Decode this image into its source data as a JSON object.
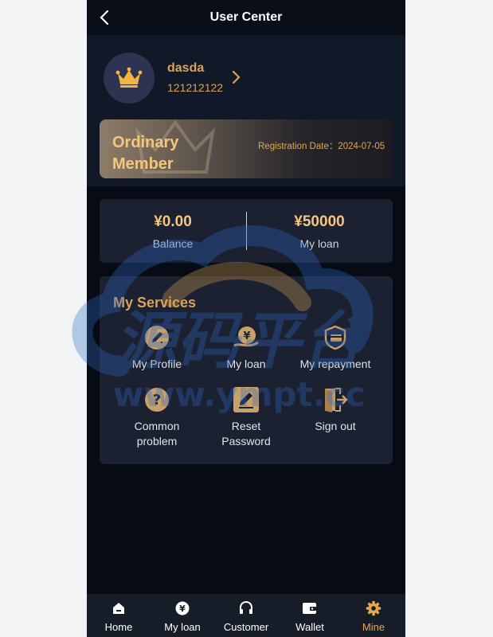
{
  "header": {
    "title": "User Center",
    "back_icon": "chevron-left-icon"
  },
  "profile": {
    "username": "dasda",
    "user_id": "121212122",
    "avatar_icon": "crown-icon",
    "arrow_icon": "chevron-right-icon"
  },
  "membership": {
    "level": "Ordinary Member",
    "registration": "Registration Date：2024-07-05"
  },
  "account": {
    "balance_value": "¥0.00",
    "balance_label": "Balance",
    "loan_value": "¥50000",
    "loan_label": "My loan"
  },
  "services": {
    "title": "My Services",
    "items": [
      {
        "label": "My Profile",
        "icon": "edit-circle-icon"
      },
      {
        "label": "My loan",
        "icon": "yen-hand-icon"
      },
      {
        "label": "My repayment",
        "icon": "shield-card-icon"
      },
      {
        "label": "Common problem",
        "icon": "question-circle-icon"
      },
      {
        "label": "Reset Password",
        "icon": "pencil-square-icon"
      },
      {
        "label": "Sign out",
        "icon": "logout-door-icon"
      }
    ]
  },
  "watermark": {
    "title": "源码平台",
    "url": "www.ympt.cc"
  },
  "tabbar": {
    "items": [
      {
        "label": "Home",
        "icon": "home-icon"
      },
      {
        "label": "My loan",
        "icon": "yen-circle-icon"
      },
      {
        "label": "Customer",
        "icon": "headset-icon"
      },
      {
        "label": "Wallet",
        "icon": "wallet-icon"
      },
      {
        "label": "Mine",
        "icon": "gear-icon"
      }
    ],
    "active": "Mine"
  },
  "colors": {
    "gold": "#d9a35a",
    "gold_light": "#f3c77d",
    "background": "#070b14",
    "card": "#1b2130"
  }
}
